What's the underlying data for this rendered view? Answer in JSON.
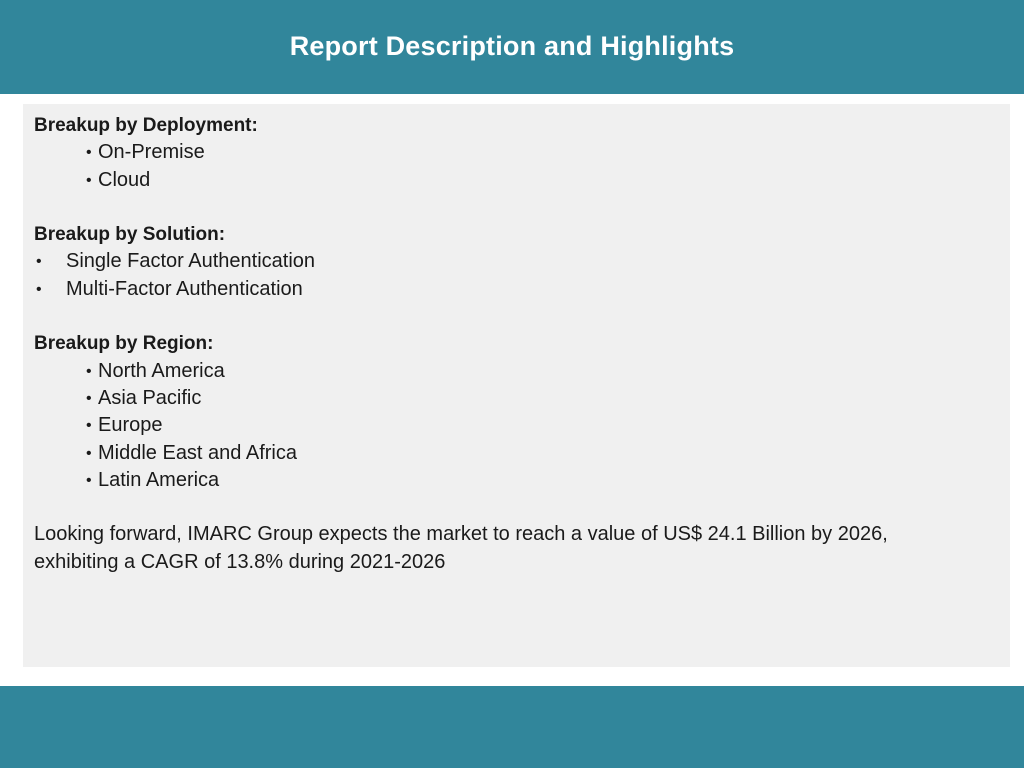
{
  "header": {
    "title": "Report Description and Highlights"
  },
  "sections": {
    "deployment": {
      "heading": "Breakup by Deployment:",
      "items": [
        "On-Premise",
        "Cloud"
      ]
    },
    "solution": {
      "heading": "Breakup by Solution:",
      "items": [
        "Single Factor Authentication",
        "Multi-Factor Authentication"
      ]
    },
    "region": {
      "heading": "Breakup by Region:",
      "items": [
        "North America",
        "Asia Pacific",
        "Europe",
        "Middle East and Africa",
        "Latin America"
      ]
    }
  },
  "bullet_glyph": "•",
  "outlook": {
    "line1": "Looking forward, IMARC Group expects the market to reach a value of US$ 24.1 Billion by 2026,",
    "line2": "exhibiting a CAGR of 13.8% during 2021-2026"
  },
  "colors": {
    "band": "#31869b",
    "panel": "#f0f0f0",
    "text": "#1a1a1a"
  }
}
